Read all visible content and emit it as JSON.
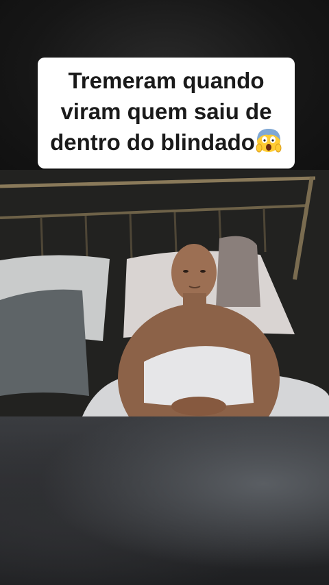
{
  "caption": {
    "text": "Tremeram quando viram quem saiu de dentro do blindado",
    "emoji_icon": "screaming-face-emoji"
  },
  "colors": {
    "caption_bg": "#ffffff",
    "caption_text": "#1a1a1a",
    "page_bg": "#151515"
  }
}
